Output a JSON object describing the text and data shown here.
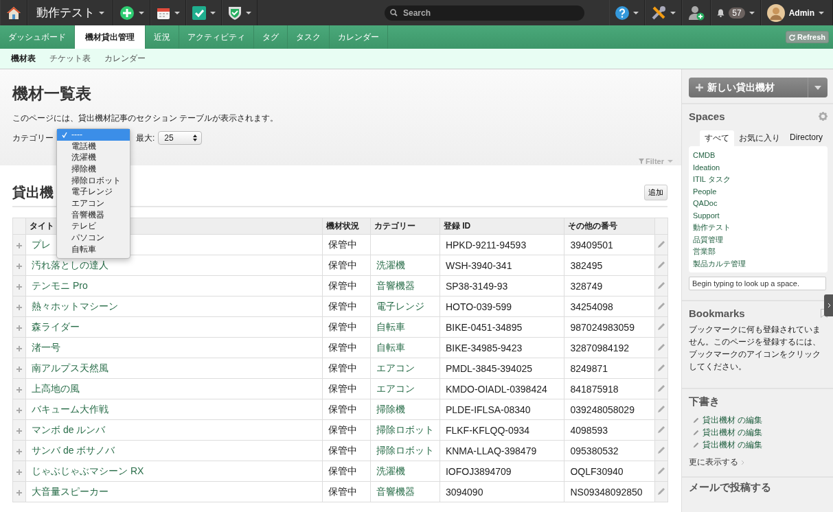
{
  "top_bar": {
    "workspace": "動作テスト",
    "search_placeholder": "Search",
    "notifications": "57",
    "user": "Admin"
  },
  "main_tabs": [
    {
      "label": "ダッシュボード",
      "selected": false
    },
    {
      "label": "機材貸出管理",
      "selected": true
    },
    {
      "label": "近況",
      "selected": false
    },
    {
      "label": "アクティビティ",
      "selected": false
    },
    {
      "label": "タグ",
      "selected": false
    },
    {
      "label": "タスク",
      "selected": false
    },
    {
      "label": "カレンダー",
      "selected": false
    }
  ],
  "refresh": "Refresh",
  "sub_tabs": [
    {
      "label": "機材表",
      "selected": true
    },
    {
      "label": "チケット表",
      "selected": false
    },
    {
      "label": "カレンダー",
      "selected": false
    }
  ],
  "page": {
    "title": "機材一覧表",
    "description": "このページには、貸出機材記事のセクション テーブルが表示されます。",
    "category_label": "カテゴリー",
    "max_label": "最大:",
    "max_value": "25",
    "filter": "Filter"
  },
  "category_dropdown": [
    {
      "label": "----",
      "selected": true
    },
    {
      "label": "電話機",
      "selected": false
    },
    {
      "label": "洗濯機",
      "selected": false
    },
    {
      "label": "掃除機",
      "selected": false
    },
    {
      "label": "掃除ロボット",
      "selected": false
    },
    {
      "label": "電子レンジ",
      "selected": false
    },
    {
      "label": "エアコン",
      "selected": false
    },
    {
      "label": "音響機器",
      "selected": false
    },
    {
      "label": "テレビ",
      "selected": false
    },
    {
      "label": "パソコン",
      "selected": false
    },
    {
      "label": "自転車",
      "selected": false
    }
  ],
  "section": {
    "heading": "貸出機",
    "add_button": "追加"
  },
  "table": {
    "columns": [
      "タイト",
      "機材状況",
      "カテゴリー",
      "登録 ID",
      "その他の番号"
    ],
    "rows": [
      {
        "title": "プレ",
        "status": "保管中",
        "id": "HPKD-9211-94593",
        "other": "39409501"
      },
      {
        "title": "汚れ落としの達人",
        "status": "保管中",
        "category": "洗濯機",
        "id": "WSH-3940-341",
        "other": "382495"
      },
      {
        "title": "テンモニ Pro",
        "status": "保管中",
        "category": "音響機器",
        "id": "SP38-3149-93",
        "other": "328749"
      },
      {
        "title": "熱々ホットマシーン",
        "status": "保管中",
        "category": "電子レンジ",
        "id": "HOTO-039-599",
        "other": "34254098"
      },
      {
        "title": "森ライダー",
        "status": "保管中",
        "category": "自転車",
        "id": "BIKE-0451-34895",
        "other": "987024983059"
      },
      {
        "title": "渚一号",
        "status": "保管中",
        "category": "自転車",
        "id": "BIKE-34985-9423",
        "other": "32870984192"
      },
      {
        "title": "南アルプス天然風",
        "status": "保管中",
        "category": "エアコン",
        "id": "PMDL-3845-394025",
        "other": "8249871"
      },
      {
        "title": "上高地の風",
        "status": "保管中",
        "category": "エアコン",
        "id": "KMDO-OIADL-0398424",
        "other": "841875918"
      },
      {
        "title": "バキューム大作戦",
        "status": "保管中",
        "category": "掃除機",
        "id": "PLDE-IFLSA-08340",
        "other": "039248058029"
      },
      {
        "title": "マンボ de ルンバ",
        "status": "保管中",
        "category": "掃除ロボット",
        "id": "FLKF-KFLQQ-0934",
        "other": "4098593"
      },
      {
        "title": "サンバ de ボサノバ",
        "status": "保管中",
        "category": "掃除ロボット",
        "id": "KNMA-LLAQ-398479",
        "other": "095380532"
      },
      {
        "title": "じゃぶじゃぶマシーン RX",
        "status": "保管中",
        "category": "洗濯機",
        "id": "IOFOJ3894709",
        "other": "OQLF30940"
      },
      {
        "title": "大音量スピーカー",
        "status": "保管中",
        "category": "音響機器",
        "id": "3094090",
        "other": "NS09348092850"
      }
    ]
  },
  "sidebar": {
    "new_button": "新しい貸出機材",
    "spaces": {
      "heading": "Spaces",
      "tabs": [
        {
          "label": "すべて",
          "selected": true
        },
        {
          "label": "お気に入り",
          "selected": false
        },
        {
          "label": "Directory",
          "selected": false
        }
      ],
      "items": [
        "CMDB",
        "Ideation",
        "ITIL タスク",
        "People",
        "QADoc",
        "Support",
        "動作テスト",
        "品質管理",
        "営業部",
        "製品カルテ管理"
      ],
      "search_placeholder": "Begin typing to look up a space."
    },
    "bookmarks": {
      "heading": "Bookmarks",
      "text": "ブックマークに何も登録されていません。このページを登録するには、ブックマークのアイコンをクリックしてください。"
    },
    "drafts": {
      "heading": "下書き",
      "items": [
        "貸出機材 の編集",
        "貸出機材 の編集",
        "貸出機材 の編集"
      ],
      "more": "更に表示する"
    },
    "email": {
      "heading": "メールで投稿する"
    }
  }
}
